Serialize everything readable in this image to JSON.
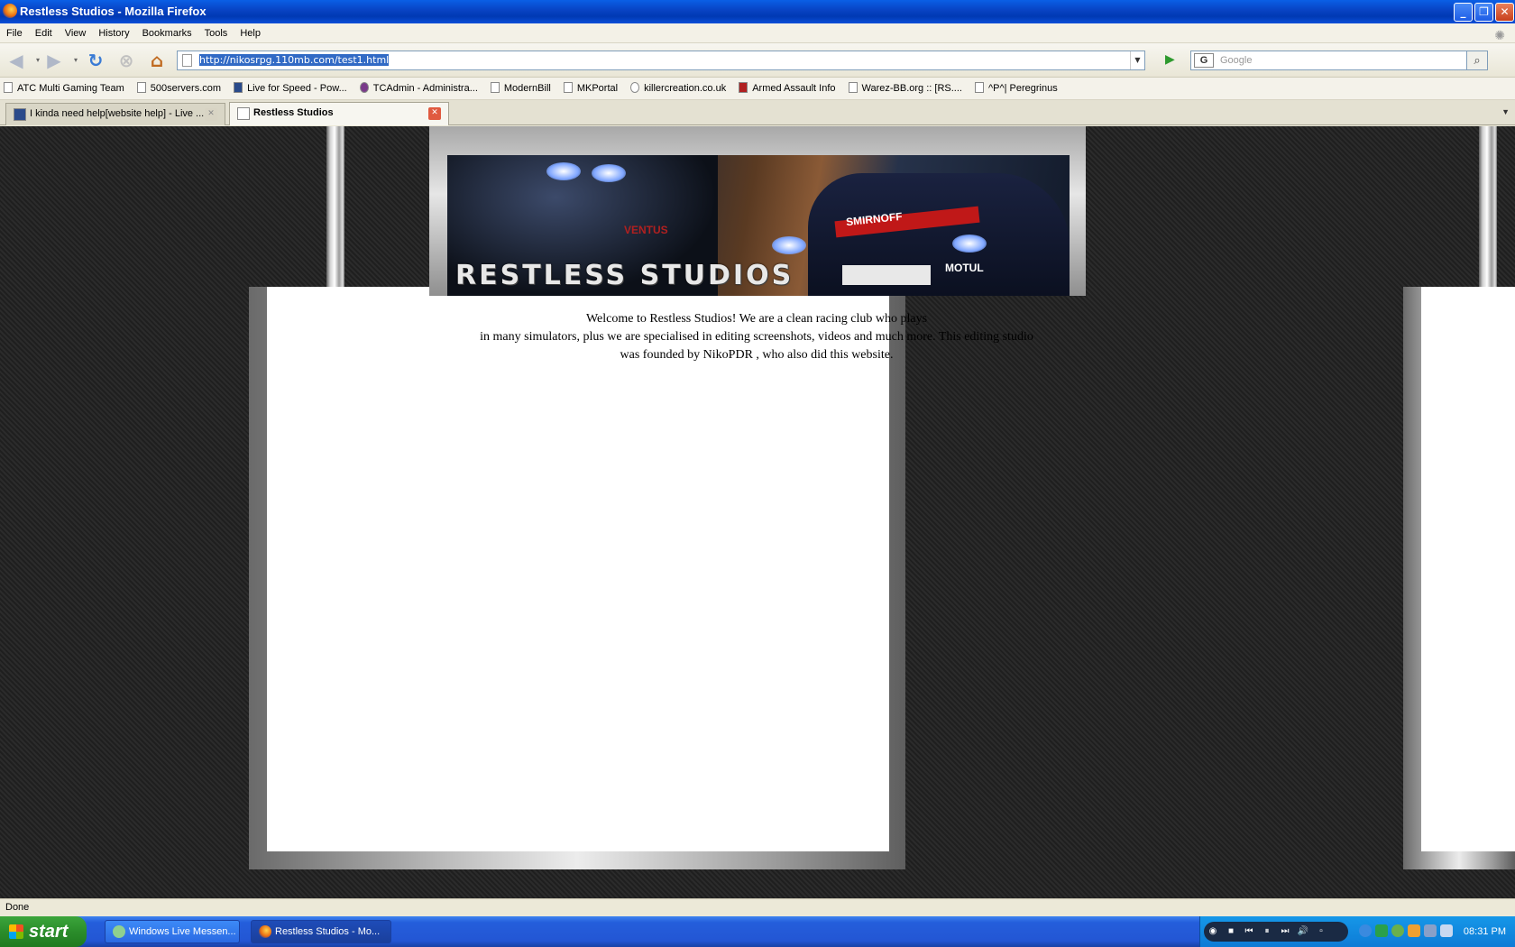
{
  "window": {
    "title": "Restless Studios - Mozilla Firefox",
    "minimize_icon": "minimize-icon",
    "maximize_icon": "restore-icon",
    "close_icon": "close-icon"
  },
  "menu": [
    "File",
    "Edit",
    "View",
    "History",
    "Bookmarks",
    "Tools",
    "Help"
  ],
  "toolbar": {
    "url": "http://nikosrpg.110mb.com/test1.html",
    "search_placeholder": "Google",
    "search_engine_letter": "G"
  },
  "bookmarks": [
    "ATC Multi Gaming Team",
    "500servers.com",
    "Live for Speed - Pow...",
    "TCAdmin - Administra...",
    "ModernBill",
    "MKPortal",
    "killercreation.co.uk",
    "Armed Assault Info",
    "Warez-BB.org :: [RS....",
    "^P^| Peregrinus"
  ],
  "tabs": [
    {
      "label": "I kinda need help[website help] - Live ...",
      "active": false
    },
    {
      "label": "Restless Studios",
      "active": true
    }
  ],
  "page": {
    "banner_title": "RESTLESS STUDIOS",
    "banner_sponsor_1": "VENTUS",
    "banner_sponsor_2": "SMIRNOFF",
    "banner_sponsor_3": "MOTUL",
    "welcome_line1": "Welcome to Restless Studios! We are a clean racing club who plays",
    "welcome_line2": "in many simulators, plus we are specialised in editing screenshots, videos and much more. This editing studio",
    "welcome_line3": "was founded by NikoPDR , who also did this website."
  },
  "status": "Done",
  "taskbar": {
    "start": "start",
    "tasks": [
      {
        "label": "Windows Live Messen...",
        "active": false
      },
      {
        "label": "Restless Studios - Mo...",
        "active": true
      }
    ],
    "clock": "08:31 PM"
  },
  "colors": {
    "titlebar": "#0842c2",
    "taskbar": "#245edb",
    "start": "#2b8d2b",
    "page_background": "#2b2b2b"
  }
}
